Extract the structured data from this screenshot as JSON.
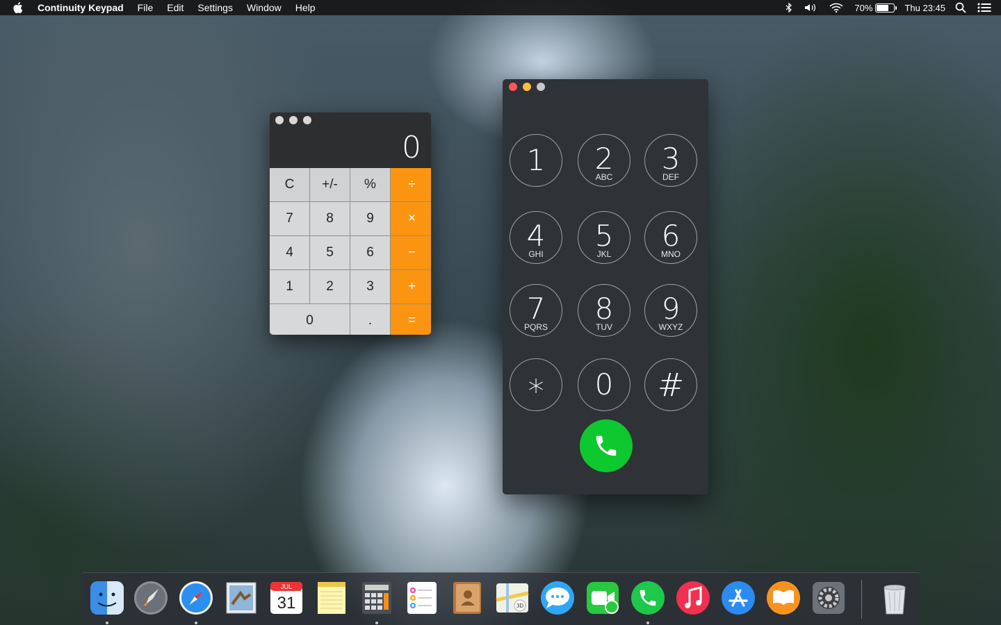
{
  "menubar": {
    "app_name": "Continuity Keypad",
    "items": [
      "File",
      "Edit",
      "Settings",
      "Window",
      "Help"
    ],
    "battery_percent": "70%",
    "battery_level": 0.7,
    "clock": "Thu 23:45"
  },
  "calculator": {
    "display": "0",
    "keys": [
      {
        "label": "C",
        "kind": "fn"
      },
      {
        "label": "+/-",
        "kind": "fn"
      },
      {
        "label": "%",
        "kind": "fn"
      },
      {
        "label": "÷",
        "kind": "op"
      },
      {
        "label": "7",
        "kind": "num"
      },
      {
        "label": "8",
        "kind": "num"
      },
      {
        "label": "9",
        "kind": "num"
      },
      {
        "label": "×",
        "kind": "op"
      },
      {
        "label": "4",
        "kind": "num"
      },
      {
        "label": "5",
        "kind": "num"
      },
      {
        "label": "6",
        "kind": "num"
      },
      {
        "label": "−",
        "kind": "op"
      },
      {
        "label": "1",
        "kind": "num"
      },
      {
        "label": "2",
        "kind": "num"
      },
      {
        "label": "3",
        "kind": "num"
      },
      {
        "label": "+",
        "kind": "op"
      },
      {
        "label": "0",
        "kind": "num"
      },
      {
        "label": ".",
        "kind": "num"
      },
      {
        "label": "=",
        "kind": "op"
      }
    ]
  },
  "keypad": {
    "keys": [
      {
        "digit": "1",
        "letters": ""
      },
      {
        "digit": "2",
        "letters": "ABC"
      },
      {
        "digit": "3",
        "letters": "DEF"
      },
      {
        "digit": "4",
        "letters": "GHI"
      },
      {
        "digit": "5",
        "letters": "JKL"
      },
      {
        "digit": "6",
        "letters": "MNO"
      },
      {
        "digit": "7",
        "letters": "PQRS"
      },
      {
        "digit": "8",
        "letters": "TUV"
      },
      {
        "digit": "9",
        "letters": "WXYZ"
      },
      {
        "digit": "*",
        "letters": ""
      },
      {
        "digit": "0",
        "letters": ""
      },
      {
        "digit": "#",
        "letters": ""
      }
    ],
    "call_color": "#0ec82f"
  },
  "dock": {
    "apps": [
      {
        "name": "finder-icon",
        "running": true
      },
      {
        "name": "launchpad-icon",
        "running": false
      },
      {
        "name": "safari-icon",
        "running": true
      },
      {
        "name": "mail-icon",
        "running": false
      },
      {
        "name": "calendar-icon",
        "running": false,
        "month": "JUL",
        "day": "31"
      },
      {
        "name": "notes-icon",
        "running": false
      },
      {
        "name": "calculator-icon",
        "running": true
      },
      {
        "name": "reminders-icon",
        "running": false
      },
      {
        "name": "contacts-icon",
        "running": false
      },
      {
        "name": "maps-icon",
        "running": false
      },
      {
        "name": "messages-icon",
        "running": false
      },
      {
        "name": "facetime-icon",
        "running": false
      },
      {
        "name": "phone-icon",
        "running": true
      },
      {
        "name": "itunes-icon",
        "running": false
      },
      {
        "name": "app-store-icon",
        "running": false
      },
      {
        "name": "ibooks-icon",
        "running": false
      },
      {
        "name": "system-preferences-icon",
        "running": false
      },
      {
        "name": "trash-icon",
        "running": false
      }
    ]
  }
}
